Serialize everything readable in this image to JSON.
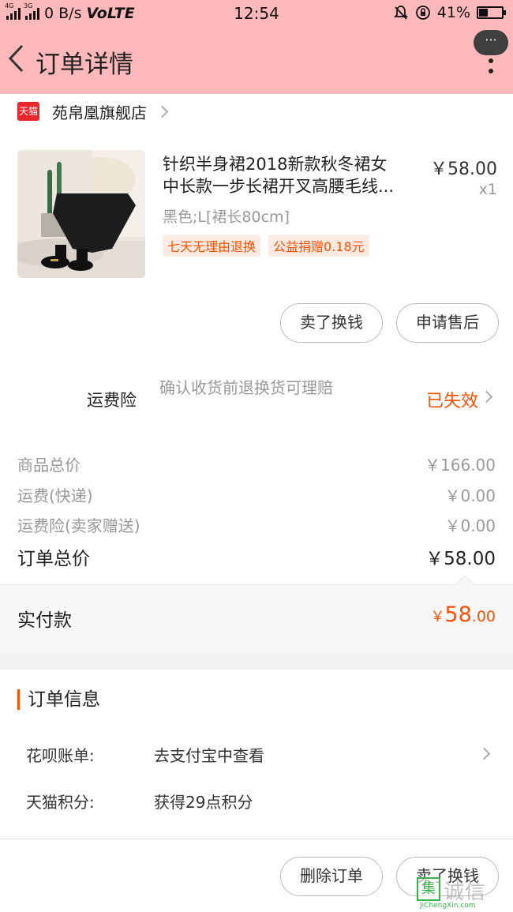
{
  "status_bar": {
    "net_left": "4G",
    "net_right": "3G",
    "speed": "0 B/s",
    "volte": "VoLTE",
    "time": "12:54",
    "battery": "41%",
    "battery_level": 0.41
  },
  "header": {
    "title": "订单详情",
    "more_label": "···"
  },
  "store": {
    "logo": "天猫",
    "name": "苑帛凰旗舰店"
  },
  "product": {
    "title_line1": "针织半身裙2018新款秋冬裙女",
    "title_line2": "中长款一步长裙开叉高腰毛线...",
    "price": "￥58.00",
    "quantity": "x1",
    "sku": "黑色;L[裙长80cm]",
    "tags": [
      "七天无理由退换",
      "公益捐赠0.18元"
    ]
  },
  "actions": {
    "sell_exchange": "卖了换钱",
    "after_sale": "申请售后"
  },
  "insurance": {
    "label": "运费险",
    "description": "确认收货前退换货可理赔",
    "status": "已失效"
  },
  "costs": [
    {
      "label": "商品总价",
      "value": "￥166.00"
    },
    {
      "label": "运费(快递)",
      "value": "￥0.00"
    },
    {
      "label": "运费险(卖家赠送)",
      "value": "￥0.00"
    }
  ],
  "order_total": {
    "label": "订单总价",
    "value": "￥58.00"
  },
  "paid": {
    "label": "实付款",
    "currency": "￥",
    "integer": "58",
    "decimal": ".00"
  },
  "order_info": {
    "title": "订单信息",
    "rows": [
      {
        "key": "花呗账单:",
        "value": "去支付宝中查看"
      },
      {
        "key": "天猫积分:",
        "value": "获得29点积分"
      }
    ]
  },
  "bottom": {
    "delete_order": "删除订单",
    "sell_exchange": "卖了换钱"
  },
  "watermark": {
    "text": "诚信",
    "box": "集",
    "sub": "JiChengXin.com"
  },
  "colors": {
    "header_bg": "#ffb9bb",
    "accent": "#ff5000",
    "tmall_red": "#e8262b"
  }
}
